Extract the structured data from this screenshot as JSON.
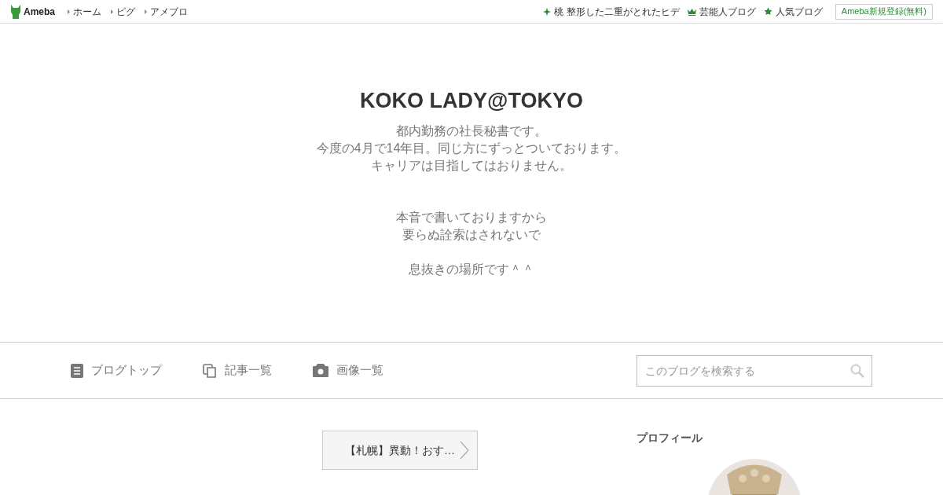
{
  "header": {
    "logo": "Ameba",
    "nav": [
      "ホーム",
      "ピグ",
      "アメブロ"
    ],
    "links": [
      {
        "kind": "sparkle",
        "label": "桃 整形した二重がとれたヒデ"
      },
      {
        "kind": "crown",
        "label": "芸能人ブログ"
      },
      {
        "kind": "star",
        "label": "人気ブログ"
      }
    ],
    "signup": "Ameba新規登録(無料)"
  },
  "blog": {
    "title": "KOKO LADY@TOKYO",
    "description": [
      [
        "都内勤務の社長秘書です。",
        "今度の4月で14年目。同じ方にずっとついております。",
        "キャリアは目指してはおりません。"
      ],
      [
        "本音で書いておりますから",
        "要らぬ詮索はされないで"
      ],
      [
        "息抜きの場所です＾＾"
      ]
    ]
  },
  "menu": [
    {
      "kind": "doc",
      "label": "ブログトップ"
    },
    {
      "kind": "copy",
      "label": "記事一覧"
    },
    {
      "kind": "camera",
      "label": "画像一覧"
    }
  ],
  "search": {
    "placeholder": "このブログを検索する"
  },
  "article_link": "【札幌】異動！おす…",
  "sidebar": {
    "heading": "プロフィール"
  }
}
